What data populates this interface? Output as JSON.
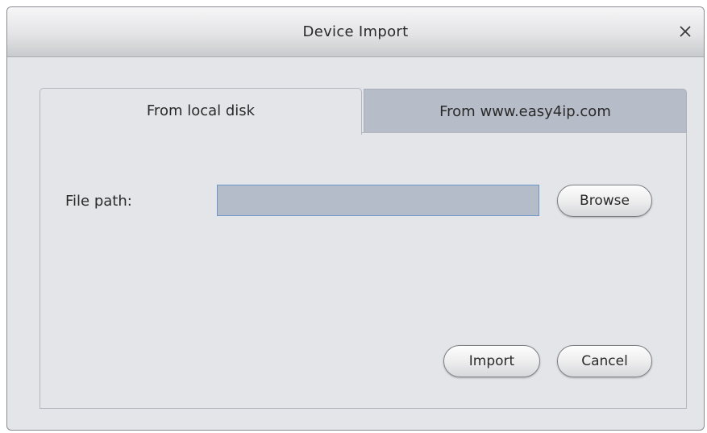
{
  "dialog": {
    "title": "Device Import",
    "close_icon": "close-icon"
  },
  "tabs": [
    {
      "label": "From local disk",
      "active": true
    },
    {
      "label": "From www.easy4ip.com",
      "active": false
    }
  ],
  "form": {
    "file_path_label": "File path:",
    "file_path_value": ""
  },
  "buttons": {
    "browse": "Browse",
    "import": "Import",
    "cancel": "Cancel"
  },
  "colors": {
    "dialog_background": "#e4e5e9",
    "inactive_tab": "#b7bcc9",
    "input_background": "#b4bbc9",
    "input_border": "#6b96c8"
  }
}
